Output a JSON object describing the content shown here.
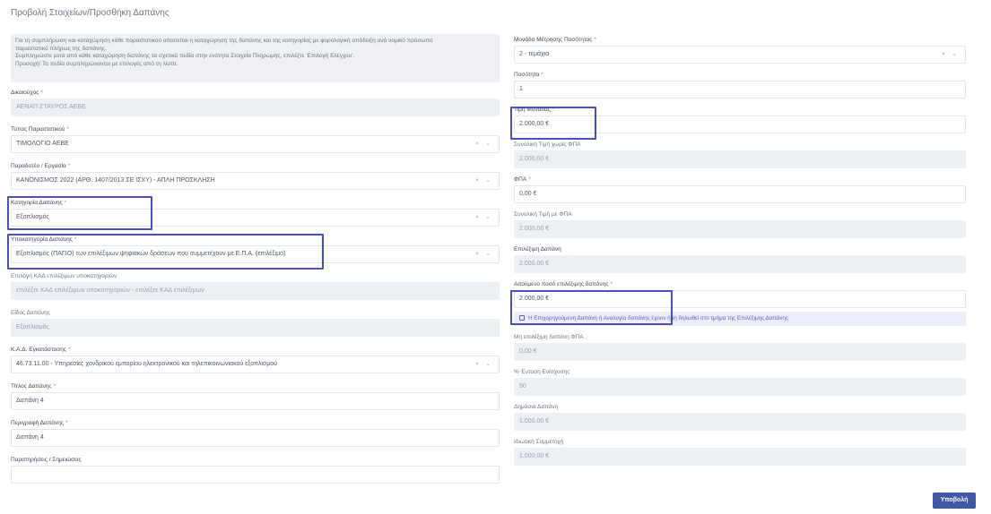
{
  "page": {
    "title": "Προβολή Στοιχείων/Προσθήκη Δαπάνης"
  },
  "info": {
    "lines": [
      "Για τη συμπλήρωση και καταχώρηση κάθε παραστατικού απαιτείται η καταχώρηση της δαπάνης και της κατηγορίας με φορολογική απόδειξη ανά νομικό πρόσωπο",
      "παραστατικό πλήρως της δαπάνης.",
      "Συμπληρώστε μετά από κάθε καταχώρηση δαπάνης τα σχετικά πεδία στην ενότητα Στοιχεία Πληρωμής, επιλέξτε 'Επιλογή Ελέγχου'.",
      "Προσοχή! Τα πεδία συμπληρώνονται με επιλογές από τη λίστα."
    ]
  },
  "left": {
    "supplier": {
      "label": "Δικαιούχος",
      "value": "ΑΕΝΑΠ ΣΤΑΥΡΟΣ ΑΕΒΕ"
    },
    "doc_type": {
      "label": "Τύπος Παραστατικού",
      "value": "ΤΙΜΟΛΟΓΙΟ ΑΕΒΕ"
    },
    "deliverable": {
      "label": "Παραδοτέο / Εργασία",
      "value": "ΚΑΝΟΝΙΣΜΟΣ 2022 (ΑΡΘ. 1407/2013 ΣΕ ΙΣΧΥ) - ΑΠΛΗ ΠΡΟΣΚΛΗΣΗ"
    },
    "category": {
      "label": "Κατηγορία Δαπάνης",
      "value": "Εξοπλισμός"
    },
    "subcategory": {
      "label": "Υποκατηγορία Δαπάνης",
      "value": "Εξοπλισμός (ΠΑΓΙΟ) των επιλέξιμων ψηφιακών δράσεων που συμμετέχουν με Ε.Π.Α. (επιλέξιμο)"
    },
    "description": {
      "label": "Επιλογή ΚΑΔ επιλέξιμων υποκατηγοριών",
      "value": "επιλέξτε ΚΑΔ επιλέξιμων υποκατηγοριών - επιλέξτε ΚΑΔ επιλέξιμων"
    },
    "type": {
      "label": "Είδος Δαπάνης",
      "value": "Εξοπλισμός"
    },
    "kad": {
      "label": "Κ.Α.Δ. Εγκατάστασης",
      "value": "46.73.11.00 - Υπηρεσίες χονδρικού εμπορίου ηλεκτρονικού και τηλεπικοινωνιακού εξοπλισμού"
    },
    "expense_name": {
      "label": "Τίτλος Δαπάνης",
      "value": "Δαπάνη 4"
    },
    "expense_desc": {
      "label": "Περιγραφή Δαπάνης",
      "value": "Δαπάνη 4"
    },
    "notes": {
      "label": "Παρατηρήσεις / Σημειώσεις",
      "value": ""
    }
  },
  "right": {
    "unit": {
      "label": "Μονάδα Μέτρησης Ποσότητας",
      "value": "2 - τεμάχια"
    },
    "quantity": {
      "label": "Ποσότητα",
      "value": "1"
    },
    "unit_price": {
      "label": "Τιμή Μονάδας",
      "value": "2.000,00 €"
    },
    "total_no_vat": {
      "label": "Συνολική Τιμή χωρίς ΦΠΑ",
      "value": "2.000,00 €"
    },
    "vat": {
      "label": "ΦΠΑ",
      "value": "0,00 €"
    },
    "total_with_vat": {
      "label": "Συνολική Τιμή με ΦΠΑ",
      "value": "2.000,00 €"
    },
    "eligible": {
      "label": "Επιλέξιμη Δαπάνη",
      "value": "2.000,00 €"
    },
    "requested": {
      "label": "Αιτούμενο ποσό επιλέξιμης δαπάνης",
      "value": "2.000,00 €"
    },
    "checkbox_label": "Η Επιχορηγούμενη Δαπάνη ή Αναλογία δαπάνης έχουν ήδη δηλωθεί στο τμήμα της Επιλέξιμης Δαπάνης",
    "non_eligible": {
      "label": "Μη επιλέξιμη δαπάνη ΦΠΑ",
      "value": "0,00 €"
    },
    "aid_percent": {
      "label": "% Ένταση Ενίσχυσης",
      "value": "50"
    },
    "public_expense": {
      "label": "Δημόσια Δαπάνη",
      "value": "1.000,00 €"
    },
    "private_share": {
      "label": "Ιδιωτική Συμμετοχή",
      "value": "1.000,00 €"
    }
  },
  "select_controls": "× ⌄",
  "submit_label": "Υποβολή",
  "colors": {
    "highlight": "#4a4fc0",
    "primary_button": "#3e57a7",
    "required_marker": "#e06464"
  }
}
